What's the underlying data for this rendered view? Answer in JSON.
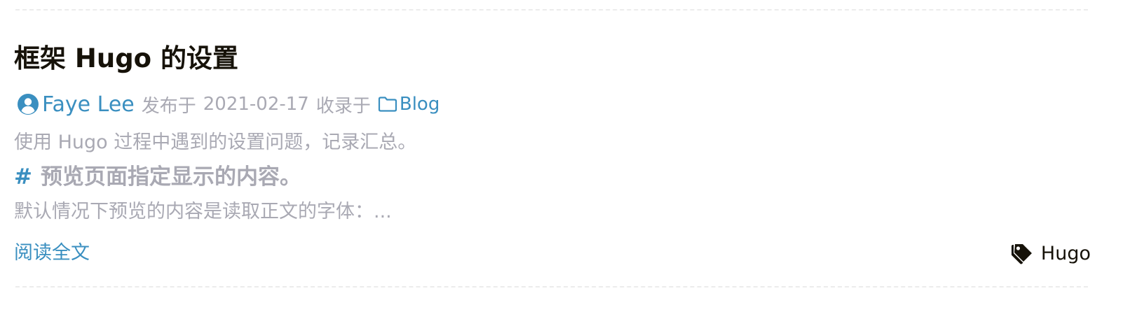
{
  "post": {
    "title": "框架 Hugo 的设置",
    "meta": {
      "author_icon": "user-circle-icon",
      "author": "Faye Lee",
      "published_label": "发布于",
      "date": "2021-02-17",
      "category_label": "收录于",
      "category_icon": "folder-icon",
      "category": "Blog"
    },
    "summary": {
      "intro": "使用 Hugo 过程中遇到的设置问题，记录汇总。",
      "heading_mark": "#",
      "heading": "预览页面指定显示的内容。",
      "excerpt": "默认情况下预览的内容是读取正文的字体：..."
    },
    "read_more": "阅读全文",
    "tags_icon": "tags-icon",
    "tags": [
      "Hugo"
    ]
  },
  "colors": {
    "accent": "#3a8fc0",
    "text": "#161209",
    "muted": "#a9a9b3",
    "divider": "#ececec"
  }
}
